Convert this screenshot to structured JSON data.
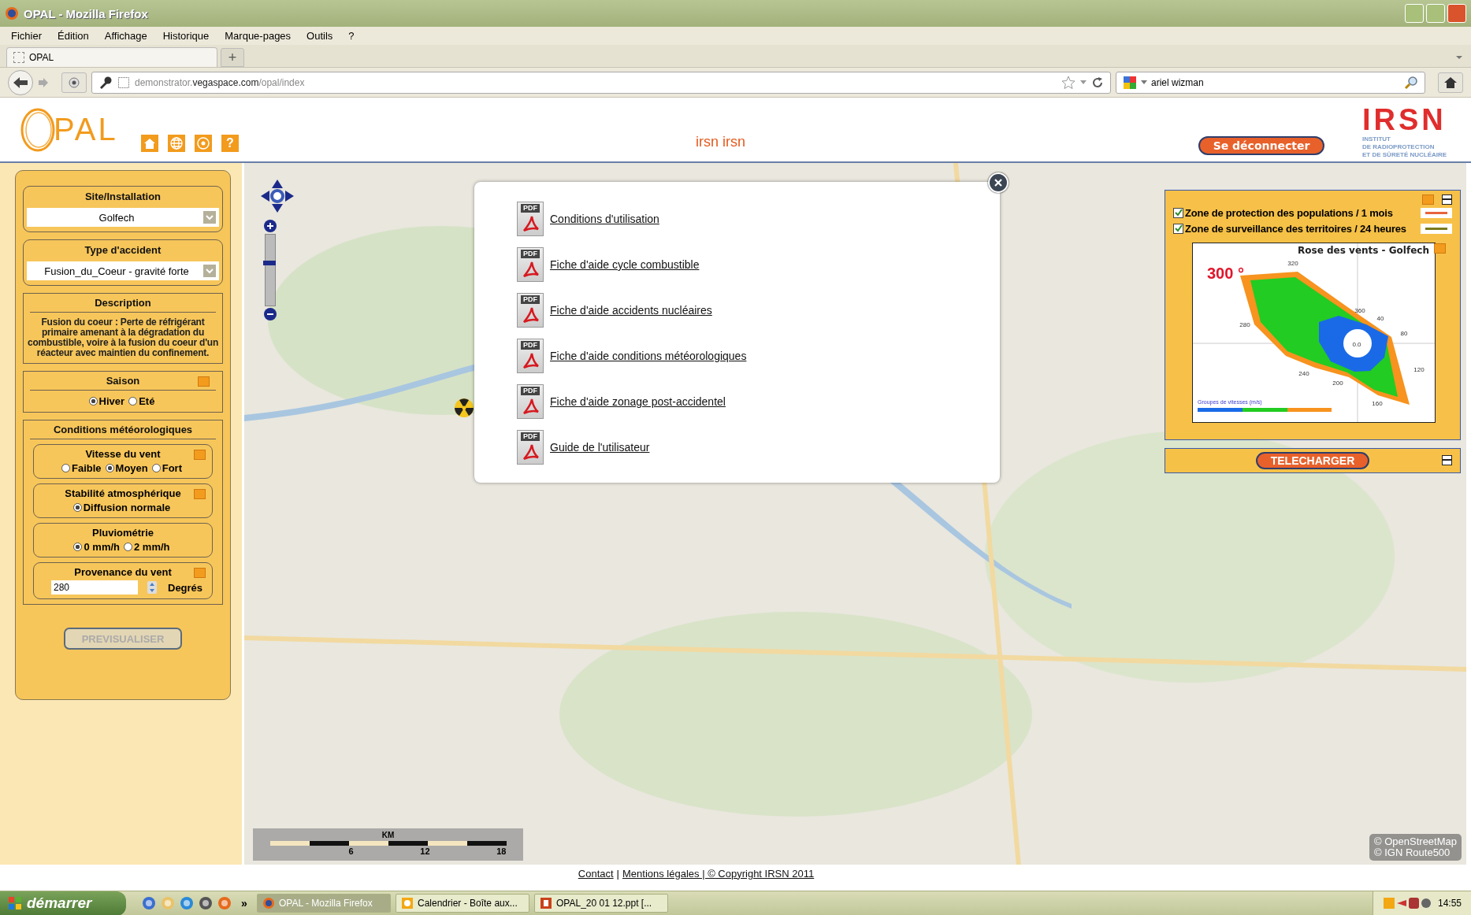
{
  "window": {
    "title": "OPAL - Mozilla Firefox"
  },
  "menu": [
    "Fichier",
    "Édition",
    "Affichage",
    "Historique",
    "Marque-pages",
    "Outils",
    "?"
  ],
  "tabs": [
    {
      "label": "OPAL",
      "selected": true
    }
  ],
  "new_tab": "+",
  "toolbar": {
    "url": "demonstrator.**vegaspace.com**/opal/index",
    "search": "ariel wizman"
  },
  "header": {
    "logo": "PAL",
    "nav_buttons": [
      {
        "kind": "home"
      },
      {
        "kind": "globe"
      },
      {
        "kind": "target"
      },
      {
        "kind": "help",
        "label": "?"
      }
    ],
    "user": "irsn irsn",
    "logout": "Se déconnecter",
    "org": {
      "name": "IRSN",
      "lines": [
        "INSTITUT",
        "DE RADIOPROTECTION",
        "ET DE SÛRETÉ NUCLÉAIRE"
      ]
    }
  },
  "left_panel": {
    "site": {
      "label": "Site/Installation",
      "value": "Golfech"
    },
    "accident": {
      "label": "Type d'accident",
      "value": "Fusion_du_Coeur - gravité forte"
    },
    "description": {
      "label": "Description",
      "text": "Fusion du coeur : Perte de réfrigérant primaire amenant à la dégradation du combustible, voire à la fusion du coeur d'un réacteur avec maintien du confinement."
    },
    "season": {
      "label": "Saison",
      "help": true,
      "options": [
        {
          "label": "Hiver",
          "selected": true
        },
        {
          "label": "Eté",
          "selected": false
        }
      ]
    },
    "meteo": {
      "label": "Conditions météorologiques",
      "groups": [
        {
          "label": "Vitesse du vent",
          "help": true,
          "options": [
            {
              "label": "Faible",
              "selected": false
            },
            {
              "label": "Moyen",
              "selected": true
            },
            {
              "label": "Fort",
              "selected": false
            }
          ]
        },
        {
          "label": "Stabilité atmosphérique",
          "help": true,
          "options": [
            {
              "label": "Diffusion normale",
              "selected": true
            }
          ]
        },
        {
          "label": "Pluviométrie",
          "help": false,
          "options": [
            {
              "label": "0 mm/h",
              "selected": true
            },
            {
              "label": "2 mm/h",
              "selected": false
            }
          ]
        }
      ],
      "wind_from": {
        "label": "Provenance du vent",
        "help": true,
        "value": "280",
        "unit": "Degrés"
      }
    },
    "button": {
      "label": "PREVISUALISER",
      "disabled": true
    }
  },
  "map": {
    "zoom": {
      "level": 0.6
    },
    "scale": [
      "KM",
      "6",
      "12",
      "18"
    ],
    "attribution": [
      "© OpenStreetMap",
      "© IGN Route500"
    ]
  },
  "modal": {
    "links": [
      {
        "label": "Conditions d'utilisation",
        "icon_label": "PDF"
      },
      {
        "label": "Fiche d'aide cycle combustible",
        "icon_label": "PDF"
      },
      {
        "label": "Fiche d'aide accidents nucléaires",
        "icon_label": "PDF"
      },
      {
        "label": "Fiche d'aide conditions météorologiques",
        "icon_label": "PDF"
      },
      {
        "label": "Fiche d'aide zonage post-accidentel",
        "icon_label": "PDF"
      },
      {
        "label": "Guide de l'utilisateur",
        "icon_label": "PDF"
      }
    ]
  },
  "layers": [
    {
      "label": "Zone de protection des populations / 1 mois",
      "checked": true,
      "color": "#e8643c"
    },
    {
      "label": "Zone de surveillance des territoires / 24 heures",
      "checked": true,
      "color": "#7a7a1e"
    }
  ],
  "rose": {
    "title": "Rose des vents - Golfech",
    "heading": "300 °",
    "labels": [
      "320",
      "360",
      "40",
      "80",
      "120",
      "160",
      "200",
      "240",
      "280",
      "0.0"
    ],
    "legend": "Groupes de vitesses (m/s)"
  },
  "download": "TELECHARGER",
  "footer": {
    "links": [
      "Contact",
      "Mentions légales | © Copyright IRSN 2011"
    ],
    "separator": "|"
  },
  "taskbar": {
    "start": "démarrer",
    "overflow": "»",
    "tasks": [
      {
        "label": "OPAL - Mozilla Firefox",
        "kind": "firefox",
        "selected": true
      },
      {
        "label": "Calendrier - Boîte aux...",
        "kind": "outlook",
        "selected": false
      },
      {
        "label": "OPAL_20 01 12.ppt [...",
        "kind": "powerpoint",
        "selected": false
      }
    ],
    "clock": "14:55"
  }
}
